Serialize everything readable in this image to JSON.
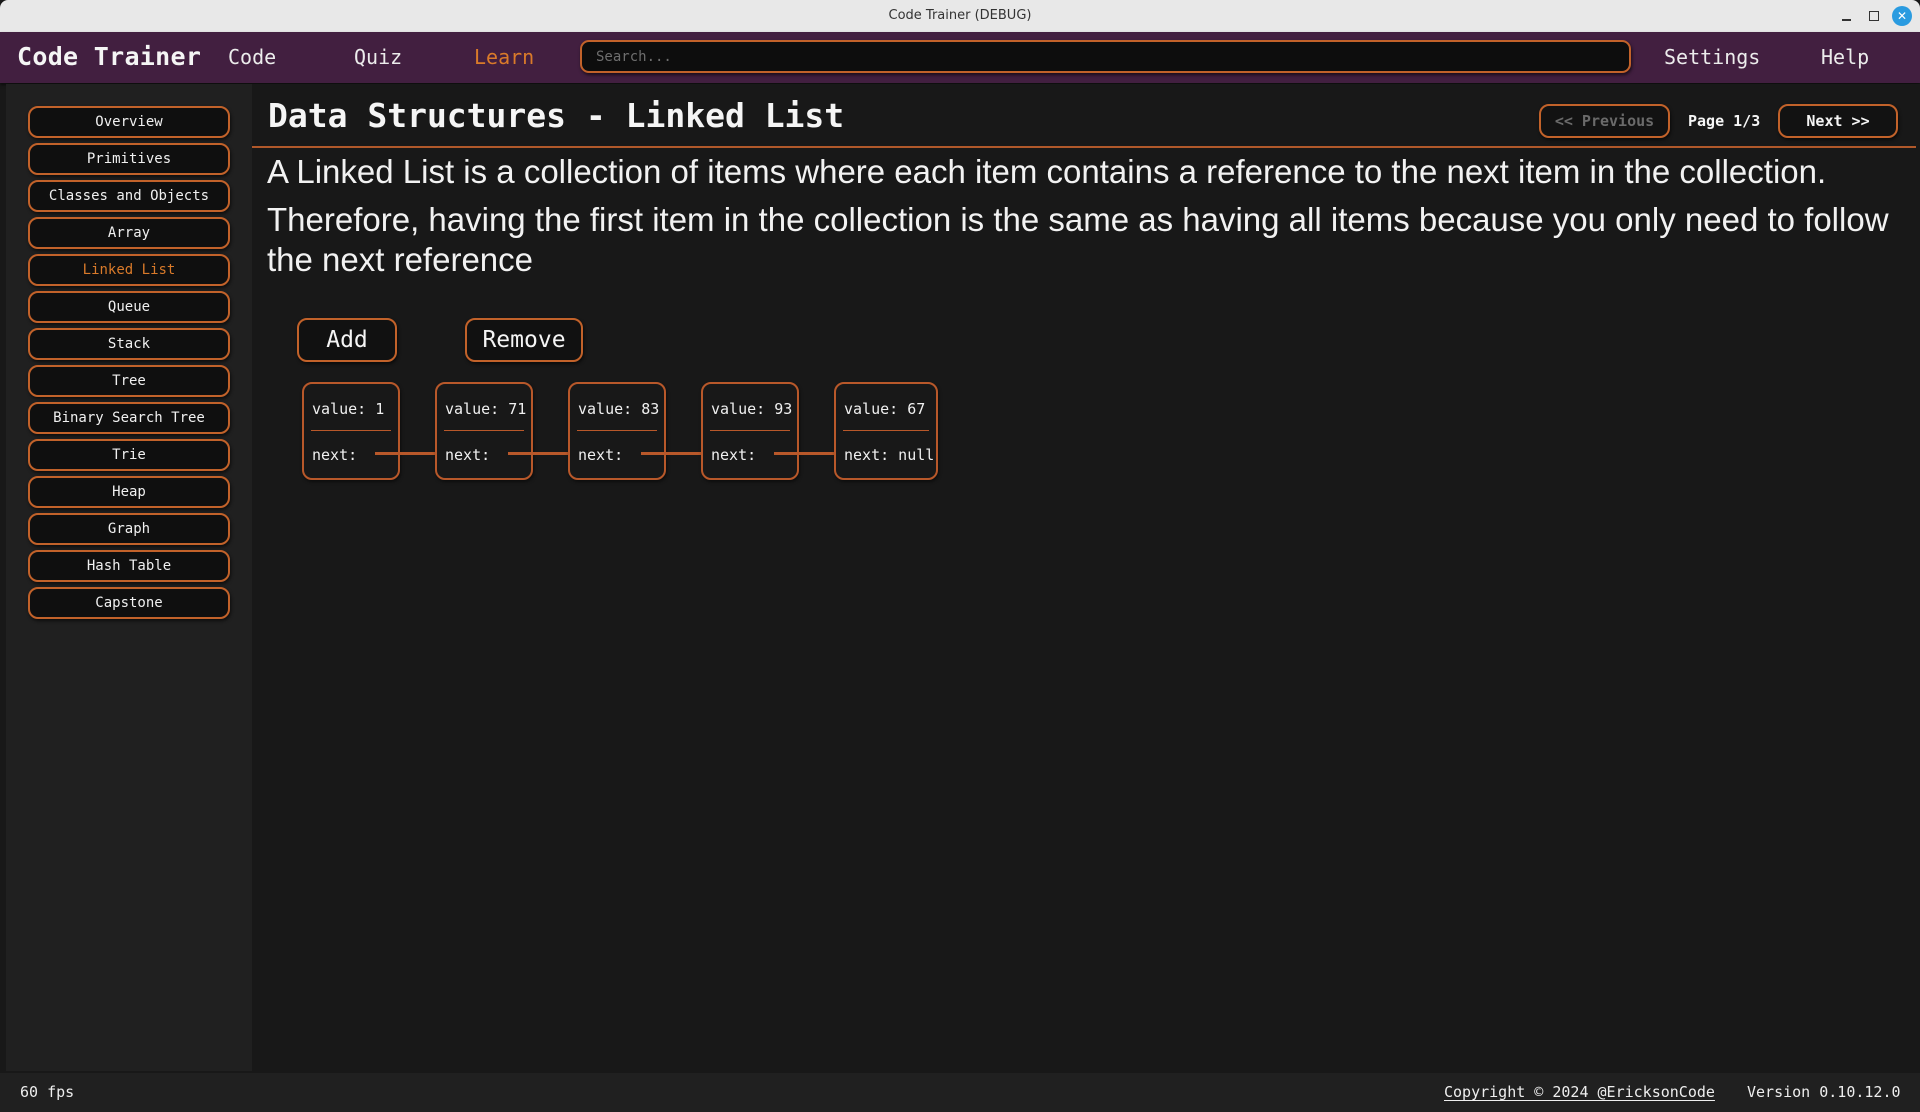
{
  "window": {
    "title": "Code Trainer (DEBUG)",
    "controls": [
      "minimize-icon",
      "maximize-icon",
      "close-icon"
    ]
  },
  "navbar": {
    "brand": "Code Trainer",
    "links": [
      {
        "label": "Code",
        "active": false
      },
      {
        "label": "Quiz",
        "active": false
      },
      {
        "label": "Learn",
        "active": true
      }
    ],
    "search": {
      "placeholder": "Search...",
      "value": ""
    },
    "settings_label": "Settings",
    "help_label": "Help"
  },
  "sidebar": {
    "items": [
      {
        "label": "Overview"
      },
      {
        "label": "Primitives"
      },
      {
        "label": "Classes and Objects"
      },
      {
        "label": "Array"
      },
      {
        "label": "Linked List",
        "active": true
      },
      {
        "label": "Queue"
      },
      {
        "label": "Stack"
      },
      {
        "label": "Tree"
      },
      {
        "label": "Binary Search Tree"
      },
      {
        "label": "Trie"
      },
      {
        "label": "Heap"
      },
      {
        "label": "Graph"
      },
      {
        "label": "Hash Table"
      },
      {
        "label": "Capstone"
      }
    ]
  },
  "main": {
    "title": "Data Structures - Linked List",
    "pager": {
      "prev_label": "<< Previous",
      "next_label": "Next >>",
      "page_text": "Page 1/3",
      "current_page": 1,
      "total_pages": 3
    },
    "description": [
      "A Linked List is a collection of items where each item contains a reference to the next item in the collection.",
      "Therefore, having the first item in the collection is the same as having all items because you only need to follow the next reference"
    ],
    "actions": {
      "add_label": "Add",
      "remove_label": "Remove"
    },
    "linked_list": {
      "value_label": "value:",
      "next_label": "next:",
      "nodes": [
        {
          "value": "1",
          "next": ""
        },
        {
          "value": "71",
          "next": ""
        },
        {
          "value": "83",
          "next": ""
        },
        {
          "value": "93",
          "next": ""
        },
        {
          "value": "67",
          "next": "null"
        }
      ]
    }
  },
  "statusbar": {
    "fps": "60 fps",
    "copyright": "Copyright © 2024 @EricksonCode",
    "version": "Version 0.10.12.0"
  },
  "colors": {
    "accent": "#c2622a",
    "active_text": "#d97a2a",
    "navbar_bg": "#421f40",
    "content_bg": "#181818",
    "sidebar_bg": "#202020"
  }
}
